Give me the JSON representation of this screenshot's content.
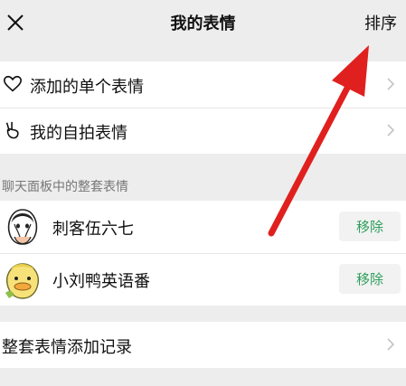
{
  "header": {
    "title": "我的表情",
    "sort_label": "排序"
  },
  "top_list": {
    "items": [
      {
        "label": "添加的单个表情",
        "icon": "heart-outline-icon"
      },
      {
        "label": "我的自拍表情",
        "icon": "victory-hand-icon"
      }
    ]
  },
  "sets": {
    "section_label": "聊天面板中的整套表情",
    "items": [
      {
        "name": "刺客伍六七",
        "action_label": "移除",
        "icon": "assassin-avatar"
      },
      {
        "name": "小刘鸭英语番",
        "action_label": "移除",
        "icon": "duck-avatar"
      }
    ]
  },
  "history": {
    "label": "整套表情添加记录"
  },
  "colors": {
    "background": "#ededed",
    "card": "#ffffff",
    "accent_green": "#2e9e5b",
    "annotation_red": "#e0201e"
  }
}
